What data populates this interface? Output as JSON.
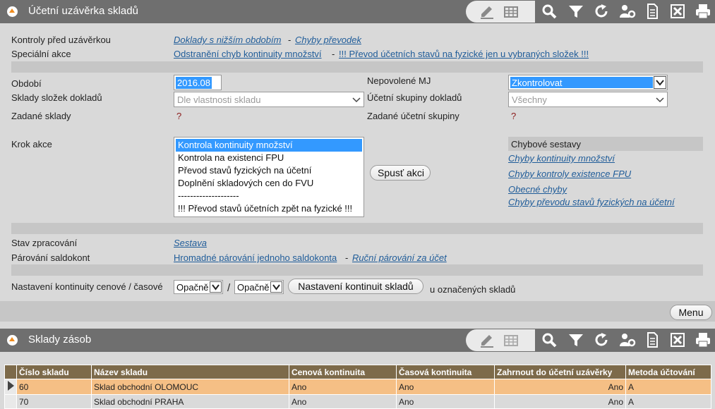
{
  "top_panel": {
    "title": "Účetní uzávěrka skladů",
    "toolbar_icons": [
      "edit-icon",
      "table-icon",
      "search-icon",
      "filter-icon",
      "refresh-icon",
      "settings-icon",
      "document-icon",
      "excel-icon",
      "print-icon"
    ]
  },
  "form": {
    "checks_label": "Kontroly před uzávěrkou",
    "checks_link1": "Doklady s nižším obdobím",
    "checks_link2": "Chyby převodek",
    "special_label": "Speciální akce",
    "special_link1": "Odstranění chyb kontinuity množství",
    "special_link2": "!!! Převod účetních stavů na fyzické jen u vybraných složek !!!",
    "separator": "-",
    "period_label": "Období",
    "period_value": "2016.08",
    "disallowed_mj_label": "Nepovolené MJ",
    "disallowed_mj_value": "Zkontrolovat",
    "stores_label": "Sklady složek dokladů",
    "stores_value": "Dle vlastnosti skladu",
    "acc_groups_label": "Účetní skupiny dokladů",
    "acc_groups_value": "Všechny",
    "given_stores_label": "Zadané sklady",
    "given_stores_value": "?",
    "given_groups_label": "Zadané účetní skupiny",
    "given_groups_value": "?",
    "step_label": "Krok akce",
    "step_options": [
      "Kontrola kontinuity množství",
      "Kontrola na existenci FPU",
      "Převod stavů fyzických na účetní",
      "Doplnění skladových cen do FVU",
      "--------------------",
      "!!! Převod stavů účetních zpět na fyzické !!!"
    ],
    "run_button": "Spusť akci",
    "error_reports_title": "Chybové sestavy",
    "error_links": [
      "Chyby kontinuity množství",
      "Chyby kontroly existence FPU",
      "Obecné chyby",
      "Chyby převodu stavů fyzických na účetní"
    ],
    "state_label": "Stav zpracování",
    "state_link": "Sestava",
    "pairing_label": "Párování saldokont",
    "pairing_link1": "Hromadné párování jednoho saldokonta",
    "pairing_link2": "Ruční párování za účet",
    "continuity_label": "Nastavení kontinuity cenové / časové",
    "continuity_price": "Opačně",
    "continuity_slash": "/",
    "continuity_time": "Opačně",
    "continuity_button": "Nastavení kontinuit skladů",
    "continuity_suffix": "u označených skladů",
    "menu_button": "Menu"
  },
  "bottom_panel": {
    "title": "Sklady zásob",
    "columns": [
      "Číslo skladu",
      "Název skladu",
      "Cenová kontinuita",
      "Časová kontinuita",
      "Zahrnout do účetní uzávěrky",
      "Metoda účtování"
    ],
    "rows": [
      {
        "cislo": "60",
        "nazev": "Sklad obchodní OLOMOUC",
        "cenova": "Ano",
        "casova": "Ano",
        "zahrnout": "Ano",
        "metoda": "A"
      },
      {
        "cislo": "70",
        "nazev": "Sklad obchodní PRAHA",
        "cenova": "Ano",
        "casova": "Ano",
        "zahrnout": "Ano",
        "metoda": "A"
      }
    ]
  },
  "colors": {
    "titlebar": "#6f6f6f",
    "link": "#1f5c99",
    "selected_row": "#f5bf85",
    "grid_header": "#7d6a4a",
    "selection_blue": "#3399ff"
  }
}
